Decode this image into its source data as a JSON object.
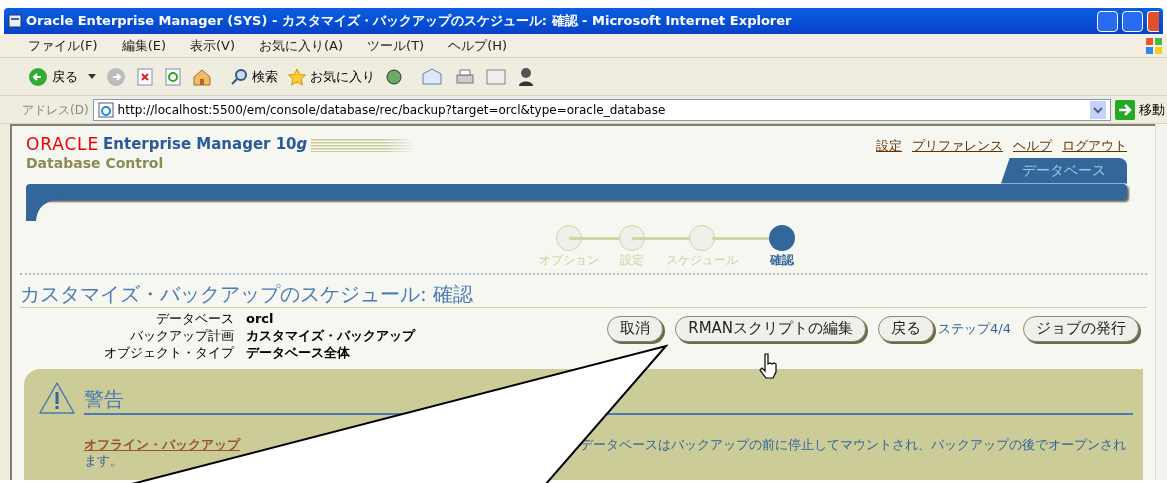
{
  "window": {
    "title": "Oracle Enterprise Manager (SYS) - カスタマイズ・バックアップのスケジュール: 確認 - Microsoft Internet Explorer"
  },
  "menu": [
    "ファイル(F)",
    "編集(E)",
    "表示(V)",
    "お気に入り(A)",
    "ツール(T)",
    "ヘルプ(H)"
  ],
  "toolbar": {
    "back": "戻る",
    "search": "検索",
    "favorites": "お気に入り"
  },
  "address": {
    "label": "アドレス(D)",
    "url": "http://localhost:5500/em/console/database/rec/backup?target=orcl&type=oracle_database",
    "go": "移動"
  },
  "header": {
    "brand": "ORACLE",
    "product": "Enterprise Manager 10",
    "product_suffix": "g",
    "subtitle": "Database Control",
    "links": [
      "設定",
      "プリファレンス",
      "ヘルプ",
      "ログアウト"
    ],
    "tab": "データベース"
  },
  "train": [
    {
      "label": "オプション",
      "selected": false
    },
    {
      "label": "設定",
      "selected": false
    },
    {
      "label": "スケジュール",
      "selected": false
    },
    {
      "label": "確認",
      "selected": true
    }
  ],
  "page_title": "カスタマイズ・バックアップのスケジュール: 確認",
  "info": [
    {
      "label": "データベース",
      "value": "orcl"
    },
    {
      "label": "バックアップ計画",
      "value": "カスタマイズ・バックアップ"
    },
    {
      "label": "オブジェクト・タイプ",
      "value": "データベース全体"
    }
  ],
  "actions": [
    {
      "kind": "button",
      "label": "取消"
    },
    {
      "kind": "button",
      "label": "RMANスクリプトの編集"
    },
    {
      "kind": "button",
      "label": "戻る"
    },
    {
      "kind": "step",
      "label": "ステップ4/4"
    },
    {
      "kind": "button",
      "label": "ジョブの発行"
    }
  ],
  "warning": {
    "title": "警告",
    "link": "オフライン・バックアップ",
    "text": "データベースはバックアップの前に停止してマウントされ、バックアップの後でオープンされ",
    "continuation": "ます。"
  }
}
